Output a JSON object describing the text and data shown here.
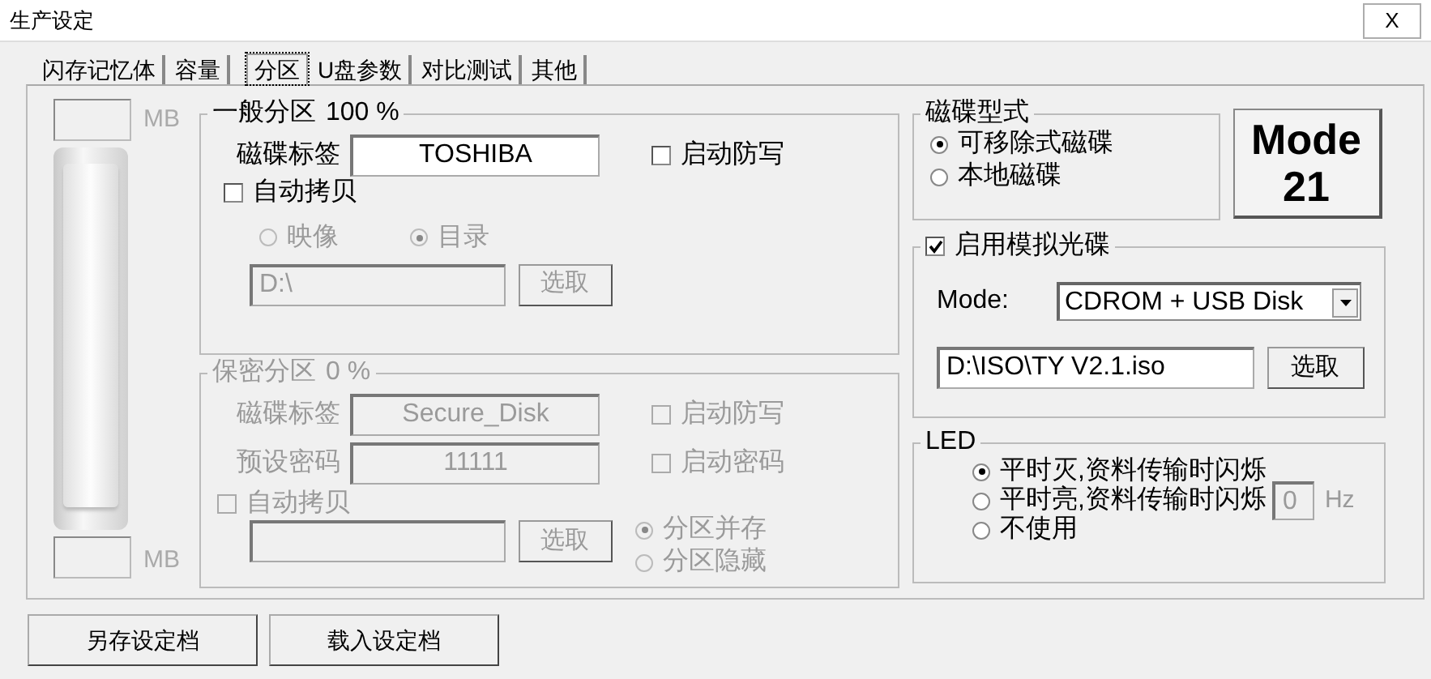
{
  "window": {
    "title": "生产设定",
    "close_label": "X"
  },
  "tabs": [
    {
      "label": "闪存记忆体",
      "selected": false
    },
    {
      "label": "容量",
      "selected": false
    },
    {
      "label": "分区",
      "selected": true
    },
    {
      "label": "U盘参数",
      "selected": false
    },
    {
      "label": "对比测试",
      "selected": false
    },
    {
      "label": "其他",
      "selected": false
    }
  ],
  "capacity": {
    "top_unit": "MB",
    "bottom_unit": "MB"
  },
  "general_partition": {
    "title": "一般分区",
    "percent": "100 %",
    "disabled": false,
    "label_caption": "磁碟标签",
    "label_value": "TOSHIBA",
    "options": [
      {
        "label": "启动防写",
        "checked": false,
        "disabled": false
      }
    ],
    "auto_copy": {
      "label": "自动拷贝",
      "checked": false,
      "disabled": false
    },
    "copy_modes": [
      {
        "label": "映像",
        "selected": false,
        "disabled": true
      },
      {
        "label": "目录",
        "selected": true,
        "disabled": true
      }
    ],
    "path": {
      "value": "D:\\",
      "disabled": true
    },
    "browse": {
      "label": "选取",
      "disabled": true
    }
  },
  "secure_partition": {
    "title": "保密分区",
    "percent": "0 %",
    "disabled": true,
    "label_caption": "磁碟标签",
    "label_value": "Secure_Disk",
    "password_caption": "预设密码",
    "password_value": "11111",
    "options": [
      {
        "label": "启动防写",
        "checked": false,
        "disabled": true
      },
      {
        "label": "启动密码",
        "checked": false,
        "disabled": true
      }
    ],
    "auto_copy": {
      "label": "自动拷贝",
      "checked": false,
      "disabled": true
    },
    "copy_modes": [
      {
        "label": "分区并存",
        "selected": true,
        "disabled": true
      },
      {
        "label": "分区隐藏",
        "selected": false,
        "disabled": true
      }
    ],
    "path": {
      "disabled": true
    },
    "browse": {
      "label": "选取",
      "disabled": true
    }
  },
  "disk_type": {
    "title": "磁碟型式",
    "options": [
      {
        "label": "可移除式磁碟",
        "selected": true
      },
      {
        "label": "本地磁碟",
        "selected": false
      }
    ]
  },
  "mode_button": {
    "lines": [
      "Mode",
      "21"
    ]
  },
  "cd_emulation": {
    "label": "启用模拟光碟",
    "checked": true,
    "mode_label": "Mode:",
    "mode_value": "CDROM + USB Disk",
    "iso_path": "D:\\ISO\\TY V2.1.iso",
    "browse": "选取"
  },
  "led": {
    "title": "LED",
    "options": [
      {
        "label": "平时灭,资料传输时闪烁",
        "selected": true
      },
      {
        "label": "平时亮,资料传输时闪烁",
        "selected": false
      },
      {
        "label": "不使用",
        "selected": false
      }
    ],
    "hz_value": "0",
    "hz_unit": "Hz",
    "hz_disabled": true
  },
  "buttons": [
    "另存设定档",
    "载入设定档"
  ]
}
